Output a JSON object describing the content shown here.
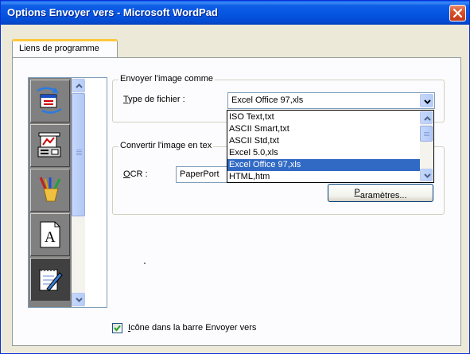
{
  "window": {
    "title": "Options Envoyer vers - Microsoft WordPad"
  },
  "tabs": [
    {
      "label": "Liens de programme"
    }
  ],
  "programs": [
    {
      "icon": "send-to-program-icon"
    },
    {
      "icon": "fax-icon"
    },
    {
      "icon": "paint-brushes-icon"
    },
    {
      "icon": "text-document-icon"
    },
    {
      "icon": "wordpad-notepad-icon",
      "selected": true
    }
  ],
  "send_as": {
    "legend": "Envoyer l'image comme",
    "file_type_label_accel": "T",
    "file_type_label_rest": "ype de fichier :",
    "file_type_value": "Excel Office 97,xls"
  },
  "file_type_options": [
    "ISO Text,txt",
    "ASCII Smart,txt",
    "ASCII Std,txt",
    "Excel 5.0,xls",
    "Excel Office 97,xls",
    "HTML,htm"
  ],
  "file_type_selected": "Excel Office 97,xls",
  "convert": {
    "legend": "Convertir l'image en tex",
    "ocr_label_accel": "O",
    "ocr_label_rest": "CR :",
    "ocr_value": "PaperPort",
    "params_button_accel": "P",
    "params_button_rest": "aramètres..."
  },
  "sendto_checkbox": {
    "checked": true,
    "label_accel": "I",
    "label_rest": "cône dans la barre Envoyer vers"
  },
  "colors": {
    "title_bar": "#0554e0",
    "selection": "#316ac5",
    "close_button": "#d9532a",
    "tab_highlight": "#ffc83c"
  }
}
